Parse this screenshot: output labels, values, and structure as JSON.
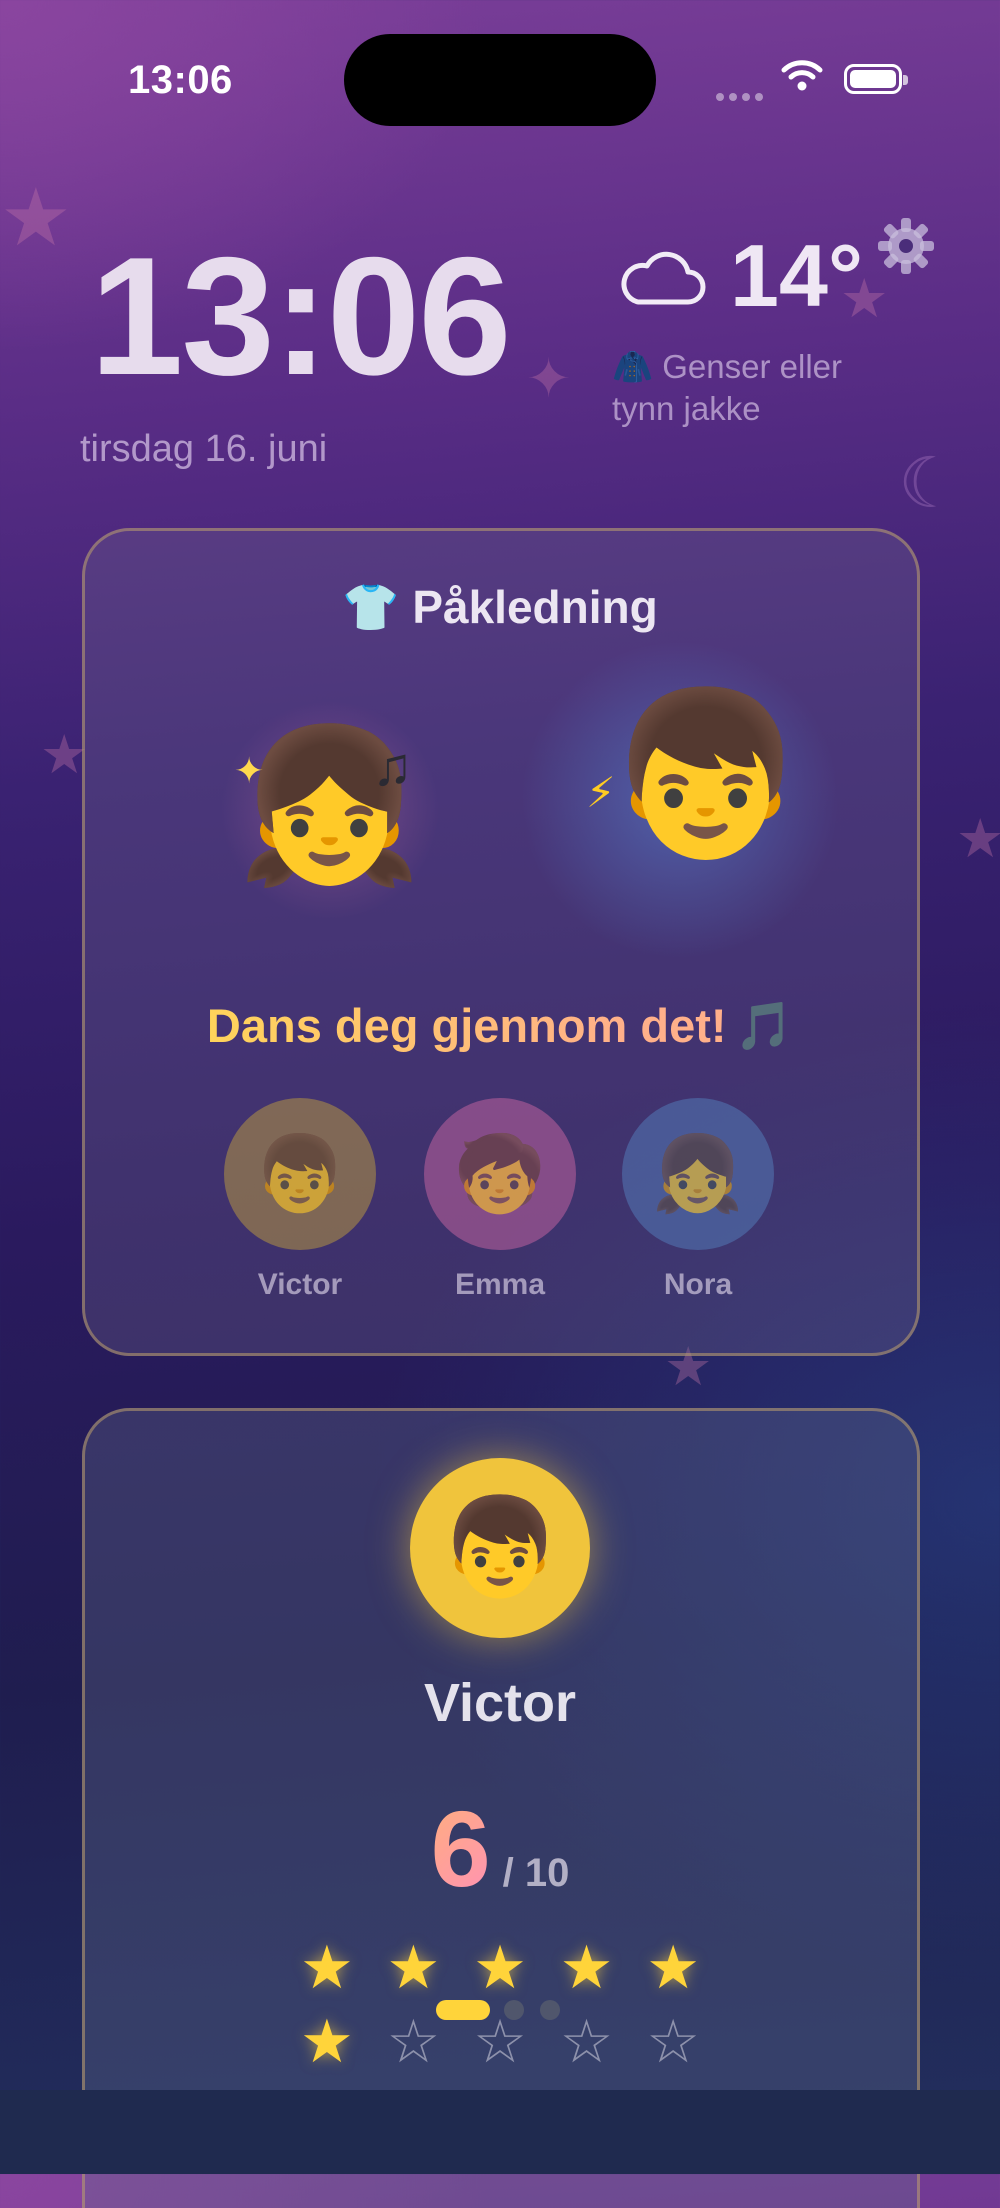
{
  "status_bar": {
    "time": "13:06"
  },
  "header": {
    "clock": "13:06",
    "date": "tirsdag 16. juni",
    "weather": {
      "icon": "cloud-icon",
      "temperature": "14°",
      "clothing_emoji": "🧥",
      "clothing_text": "Genser eller tynn jakke"
    }
  },
  "outfit_card": {
    "title_emoji": "👕",
    "title": "Påkledning",
    "characters": {
      "girl": "👧",
      "boy": "👦"
    },
    "slogan": "Dans deg gjennom det!",
    "slogan_emoji": "🎵",
    "kids": [
      {
        "name": "Victor",
        "emoji": "👦"
      },
      {
        "name": "Emma",
        "emoji": "🧒"
      },
      {
        "name": "Nora",
        "emoji": "👧"
      }
    ]
  },
  "profile_card": {
    "avatar_emoji": "👦",
    "name": "Victor",
    "score": "6",
    "score_max": "/ 10",
    "stars_filled": 6,
    "stars_total": 10
  },
  "pager": {
    "pages": 3,
    "current": 1
  },
  "colors": {
    "accent_yellow": "#ffd43a",
    "score_gradient_start": "#ffb07a",
    "score_gradient_end": "#ff90b8"
  }
}
